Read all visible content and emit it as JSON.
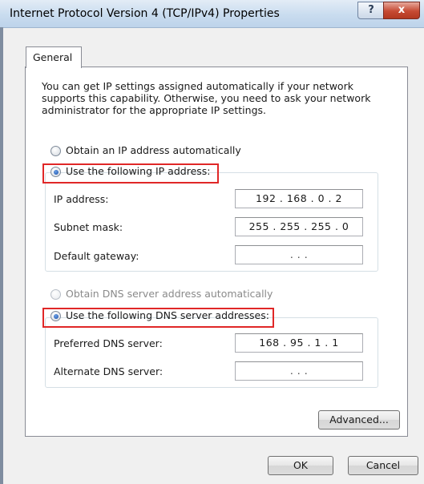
{
  "window": {
    "title": "Internet Protocol Version 4 (TCP/IPv4) Properties",
    "help_glyph": "?",
    "close_glyph": "x"
  },
  "tabs": [
    {
      "label": "General",
      "selected": true
    }
  ],
  "intro": "You can get IP settings assigned automatically if your network supports this capability. Otherwise, you need to ask your network administrator for the appropriate IP settings.",
  "ip_section": {
    "auto_label": "Obtain an IP address automatically",
    "manual_label": "Use the following IP address:",
    "selected": "manual",
    "fields": [
      {
        "label": "IP address:",
        "value": "192 . 168 .  0  .  2"
      },
      {
        "label": "Subnet mask:",
        "value": "255 . 255 . 255 .  0"
      },
      {
        "label": "Default gateway:",
        "value": ".       .       ."
      }
    ]
  },
  "dns_section": {
    "auto_label": "Obtain DNS server address automatically",
    "auto_disabled": true,
    "manual_label": "Use the following DNS server addresses:",
    "selected": "manual",
    "fields": [
      {
        "label": "Preferred DNS server:",
        "value": "168 . 95  .  1  .  1"
      },
      {
        "label": "Alternate DNS server:",
        "value": ".       .       ."
      }
    ]
  },
  "buttons": {
    "advanced": "Advanced...",
    "ok": "OK",
    "cancel": "Cancel"
  },
  "colors": {
    "highlight_border": "#e02727",
    "titlebar": "#c9dcef",
    "close_button": "#c64a33"
  }
}
